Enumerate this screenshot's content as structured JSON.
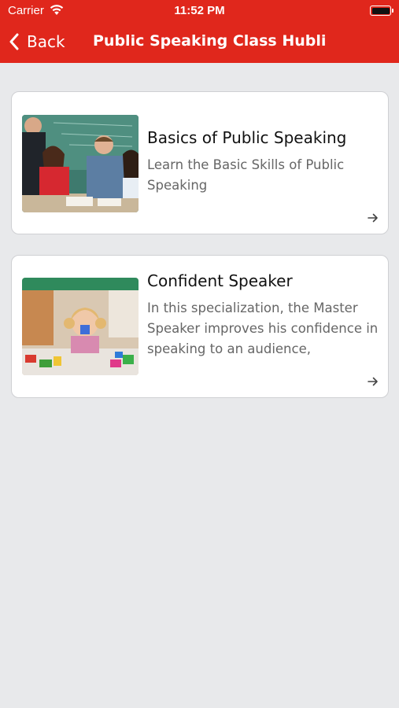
{
  "status_bar": {
    "carrier": "Carrier",
    "time": "11:52 PM",
    "wifi_icon": "wifi-icon",
    "battery_icon": "battery-icon"
  },
  "nav": {
    "back_label": "Back",
    "back_icon": "chevron-left-icon",
    "title": "Public Speaking Class Hubli"
  },
  "colors": {
    "header_bg": "#e0271c",
    "page_bg": "#e8e9eb",
    "card_bg": "#ffffff",
    "title_text": "#111111",
    "desc_text": "#666666"
  },
  "courses": [
    {
      "title": "Basics of Public Speaking",
      "description": "Learn the Basic Skills of Public Speaking",
      "image": "classroom-students-photo",
      "arrow_icon": "arrow-right-icon"
    },
    {
      "title": "Confident Speaker",
      "description": "In this specialization, the Master Speaker improves his confidence in speaking to an audience,",
      "image": "child-playing-photo",
      "arrow_icon": "arrow-right-icon"
    }
  ]
}
